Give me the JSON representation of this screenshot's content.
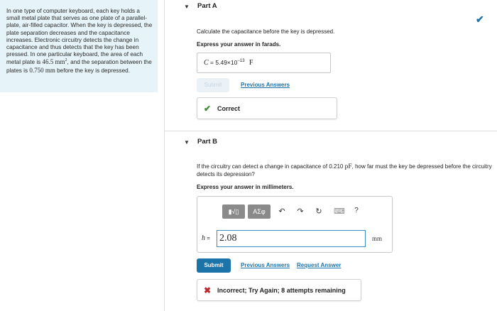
{
  "problem": {
    "text_1": "In one type of computer keyboard, each key holds a small metal plate that serves as one plate of a parallel-plate, air-filled capacitor. When the key is depressed, the plate separation decreases and the capacitance increases. Electronic circuitry detects the change in capacitance and thus detects that the key has been pressed. In one particular keyboard, the area of each metal plate is ",
    "area_value": "46.5",
    "area_unit": "mm",
    "area_exp": "2",
    "text_2": ", and the separation between the plates is ",
    "sep_value": "0.750",
    "sep_unit": "mm",
    "text_3": " before the key is depressed."
  },
  "partA": {
    "toggle": "▼",
    "title": "Part A",
    "status_icon": "✔",
    "instruction": "Calculate the capacitance before the key is depressed.",
    "format": "Express your answer in farads.",
    "answer_var": "C",
    "answer_eq": "=",
    "answer_mantissa": "5.49×10",
    "answer_exp": "−13",
    "answer_unit": "F",
    "submit_label": "Submit",
    "prev_answers_label": "Previous Answers",
    "feedback_icon": "✔",
    "feedback_text": "Correct",
    "colors": {
      "correct": "#3a8a2e",
      "accent": "#1b73a9"
    }
  },
  "partB": {
    "toggle": "▼",
    "title": "Part B",
    "instruction_1": "If the circuitry can detect a change in capacitance of 0.210 ",
    "instruction_unit": "pF",
    "instruction_2": ", how far must the key be depressed before the circuitry detects its depression?",
    "format": "Express your answer in millimeters.",
    "toolbar": {
      "templates_label": "▮√▯",
      "symbols_label": "ΑΣφ",
      "undo_icon": "↶",
      "redo_icon": "↷",
      "reset_icon": "↻",
      "keyboard_icon": "⌨",
      "help_icon": "?"
    },
    "answer_var": "h",
    "answer_eq": "=",
    "answer_value": "2.08",
    "answer_unit": "mm",
    "submit_label": "Submit",
    "prev_answers_label": "Previous Answers",
    "request_answer_label": "Request Answer",
    "feedback_icon": "✖",
    "feedback_text": "Incorrect; Try Again; 8 attempts remaining",
    "colors": {
      "incorrect": "#c0262d"
    }
  }
}
